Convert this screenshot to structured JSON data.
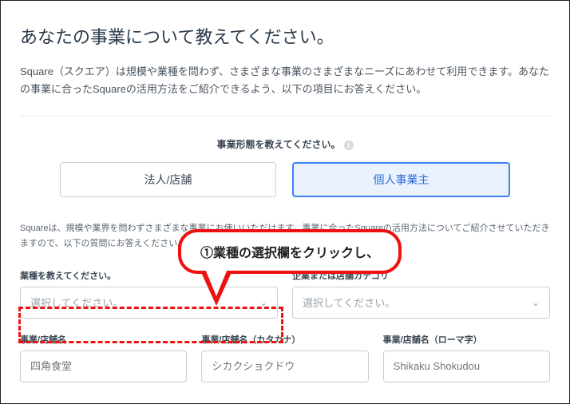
{
  "heading": "あなたの事業について教えてください。",
  "intro": "Square（スクエア）は規模や業種を問わず、さまざまな事業のさまざまなニーズにあわせて利用できます。あなたの事業に合ったSquareの活用方法をご紹介できるよう、以下の項目にお答えください。",
  "businessTypeQuestion": "事業形態を教えてください。",
  "businessTypes": {
    "corporate": "法人/店舗",
    "individual": "個人事業主"
  },
  "subIntro": "Squareは、規模や業界を問わずさまざまな事業にお使いいただけます。事業に合ったSquareの活用方法についてご紹介させていただきますので、以下の質問にお答えください。",
  "fields": {
    "industry": {
      "label": "業種を教えてください。",
      "placeholder": "選択してください。"
    },
    "category": {
      "label": "企業または店舗カテゴリ",
      "placeholder": "選択してください。"
    },
    "name": {
      "label": "事業/店舗名",
      "placeholder": "四角食堂"
    },
    "nameKana": {
      "label": "事業/店舗名（カタカナ）",
      "placeholder": "シカクショクドウ"
    },
    "nameRoman": {
      "label": "事業/店舗名（ローマ字）",
      "placeholder": "Shikaku Shokudou"
    }
  },
  "callout": "①業種の選択欄をクリックし、"
}
